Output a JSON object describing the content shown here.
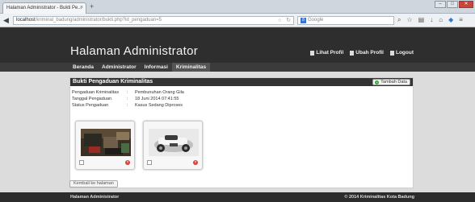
{
  "browser": {
    "tab_title": "Halaman Administrator - Bukti Pe...",
    "tab_close": "×",
    "new_tab": "+",
    "url_host": "localhost",
    "url_path": "/kriminal_badung/administrator/bukti.php?id_pengaduan=5",
    "search_engine_badge": "8",
    "search_placeholder": "Google",
    "win_min": "–",
    "win_max": "□",
    "win_close": "✕"
  },
  "site": {
    "title": "Halaman Administrator",
    "top_links": [
      "Lihat Profil",
      "Ubah Profil",
      "Logout"
    ],
    "menu": [
      "Beranda",
      "Administrator",
      "Informasi",
      "Kriminalitas"
    ],
    "active_menu": "Kriminalitas"
  },
  "panel": {
    "title": "Bukti Pengaduan Kriminalitas",
    "add_button": "Tambah Data",
    "fields": [
      {
        "label": "Pengaduan Kriminalitas",
        "value": "Pembunuhan Orang Gila"
      },
      {
        "label": "Tanggal Pengaduan",
        "value": "18 Juni 2014 07:41:55"
      },
      {
        "label": "Status Pengaduan",
        "value": "Kasus Sedang Diproses"
      }
    ],
    "separator": ":"
  },
  "back_button": "Kembali ke halaman",
  "footer": {
    "left": "Halaman Administrator",
    "right": "© 2014 Kriminalitas Kota Badung"
  },
  "colors": {
    "header_bg": "#2e2e2e",
    "content_bg": "#dcdcdc",
    "add_icon": "#3aa33a",
    "delete_icon": "#d9413a"
  }
}
